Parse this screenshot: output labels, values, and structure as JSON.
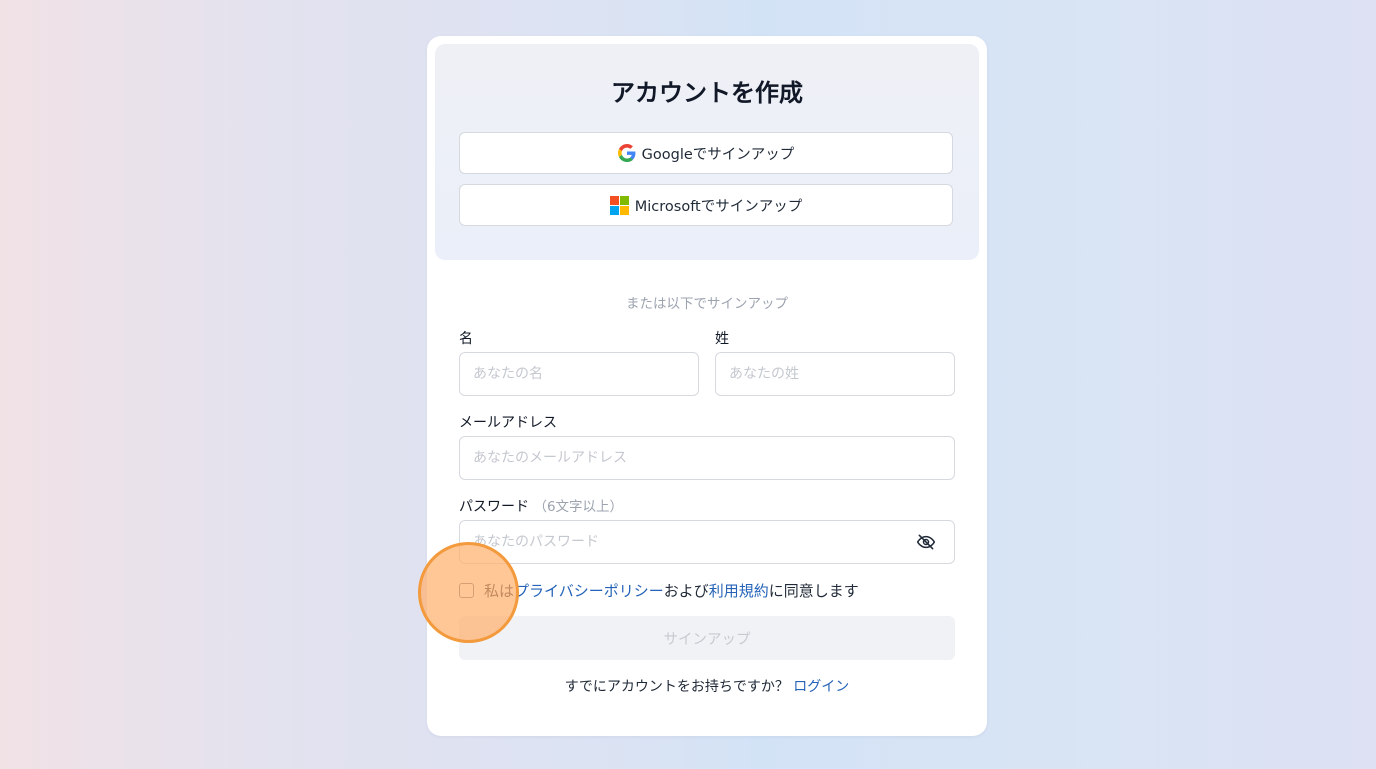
{
  "signup": {
    "title": "アカウントを作成",
    "google_button": "Googleでサインアップ",
    "microsoft_button": "Microsoftでサインアップ",
    "divider": "または以下でサインアップ",
    "first_name": {
      "label": "名",
      "placeholder": "あなたの名",
      "value": ""
    },
    "last_name": {
      "label": "姓",
      "placeholder": "あなたの姓",
      "value": ""
    },
    "email": {
      "label": "メールアドレス",
      "placeholder": "あなたのメールアドレス",
      "value": ""
    },
    "password": {
      "label": "パスワード",
      "hint": "（6文字以上）",
      "placeholder": "あなたのパスワード",
      "value": ""
    },
    "consent": {
      "prefix": "私は",
      "privacy_link": "プライバシーポリシー",
      "middle": "および",
      "terms_link": "利用規約",
      "suffix": "に同意します",
      "checked": false
    },
    "submit_button": "サインアップ",
    "login_prompt": "すでにアカウントをお持ちですか？",
    "login_link": "ログイン"
  },
  "icons": {
    "google": "google-logo-icon",
    "microsoft": "microsoft-logo-icon",
    "password_toggle": "eye-off-icon"
  },
  "colors": {
    "link": "#2563b8",
    "click_marker": "#f39a3d",
    "ms_red": "#f25022",
    "ms_green": "#7fba00",
    "ms_blue": "#00a4ef",
    "ms_yellow": "#ffb900"
  }
}
